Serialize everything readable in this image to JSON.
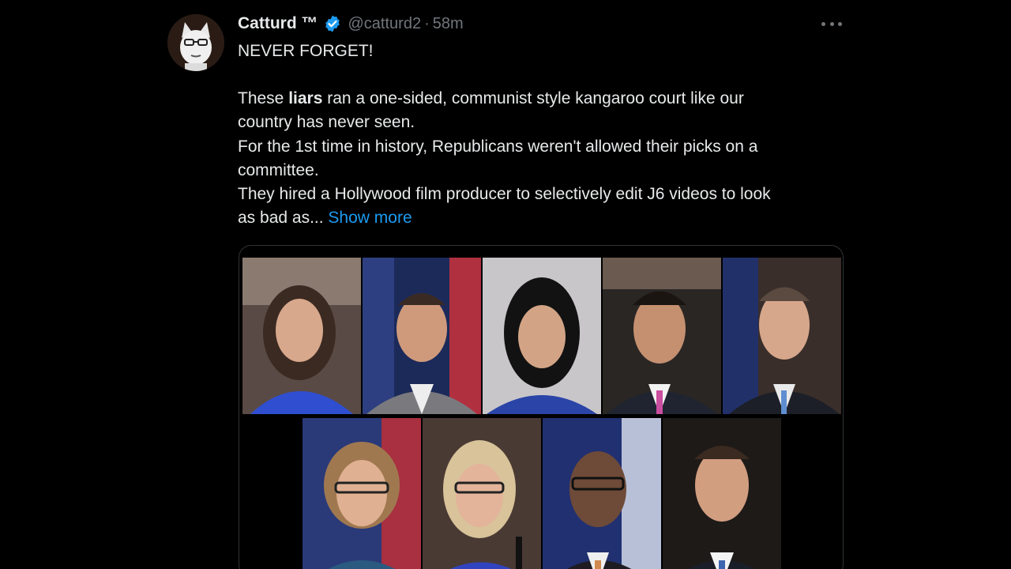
{
  "tweet": {
    "author_name": "Catturd ™",
    "handle": "@catturd2",
    "separator": "·",
    "time": "58m",
    "line1": "NEVER FORGET!",
    "p2_pre": "These ",
    "p2_bold": "liars",
    "p2_post": " ran a one-sided, communist style kangaroo court like our",
    "p2_line2": "country has never seen.",
    "p3_line1": "For the 1st time in history, Republicans weren't allowed their picks on a",
    "p3_line2": "committee.",
    "p4_line1": "They hired a Hollywood film producer to selectively edit J6 videos to look",
    "p4_line2": "as bad as...",
    "show_more": "Show more"
  },
  "icons": {
    "verified": "verified-badge-icon",
    "more": "more-options-icon",
    "avatar": "cartoon-cat-avatar"
  },
  "colors": {
    "background": "#000000",
    "text": "#e7e9ea",
    "muted": "#71767b",
    "link": "#1d9bf0",
    "verified": "#1d9bf0"
  },
  "media": {
    "photo_count": 9,
    "description_row1": 5,
    "description_row2": 4
  }
}
